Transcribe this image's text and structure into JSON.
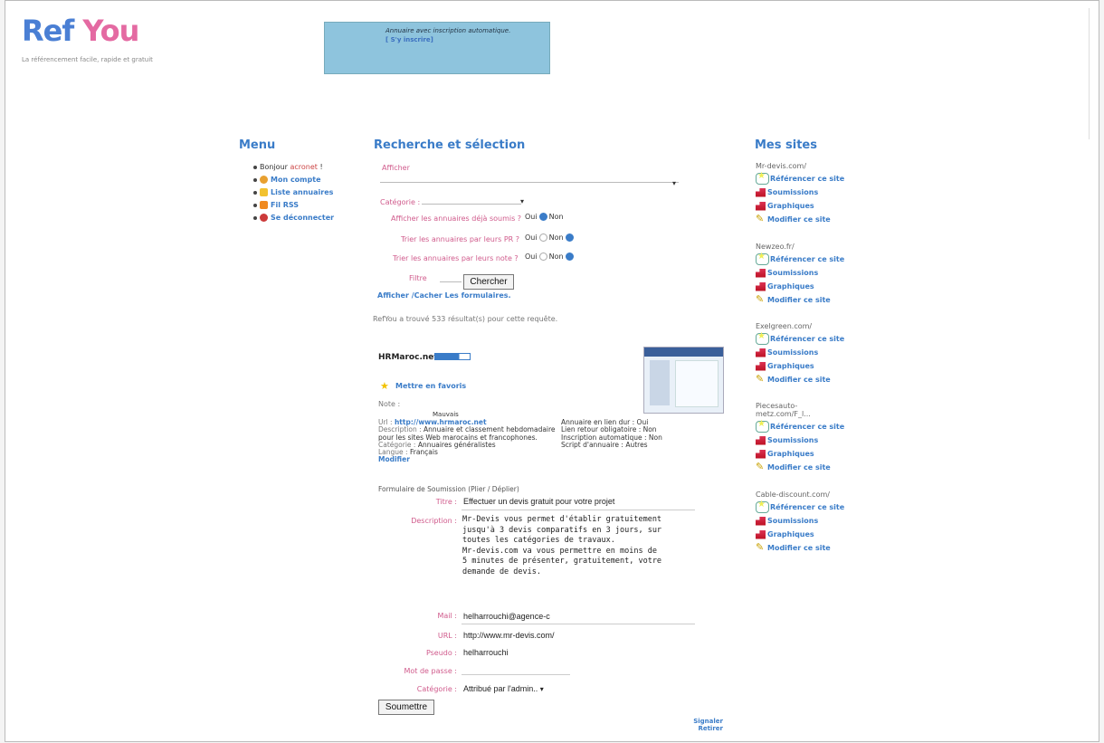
{
  "header": {
    "logo_ref": "Ref",
    "logo_you": "You",
    "tagline": "La référencement facile, rapide et gratuit",
    "banner_text": "Annuaire avec inscription automatique.",
    "banner_link": "[ S'y inscrire]"
  },
  "menu": {
    "title": "Menu",
    "greeting": "Bonjour",
    "username": "acronet",
    "greeting_suffix": "!",
    "items": [
      {
        "label": "Mon compte",
        "icon": "users-icon",
        "color": "#e8a030"
      },
      {
        "label": "Liste annuaires",
        "icon": "folder-icon",
        "color": "#f2c230"
      },
      {
        "label": "Fil RSS",
        "icon": "rss-icon",
        "color": "#f08a20"
      },
      {
        "label": "Se déconnecter",
        "icon": "logout-icon",
        "color": "#cc3a3a"
      }
    ]
  },
  "search": {
    "title": "Recherche et sélection",
    "afficher_label": "Afficher",
    "categorie_label": "Catégorie :",
    "opt1_label": "Afficher les annuaires déjà soumis ?",
    "opt2_label": "Trier les annuaires par leurs PR ?",
    "opt3_label": "Trier les annuaires par leurs note ?",
    "oui": "Oui",
    "non": "Non",
    "filtre_label": "Filtre",
    "search_button": "Chercher",
    "toggle_forms": "Afficher /Cacher Les formulaires.",
    "result_text": "RefYou a trouvé 533 résultat(s) pour cette requête."
  },
  "site_card": {
    "name": "HRMaroc.net",
    "favorite": "Mettre en favoris",
    "note_label": "Note :",
    "note_value": "Mauvais",
    "url_label": "Url :",
    "url_value": "http://www.hrmaroc.net",
    "description_label": "Description :",
    "description_value": "Annuaire et classement hebdomadaire pour les sites Web marocains et francophones.",
    "categorie_label": "Catégorie :",
    "categorie_value": "Annuaires généralistes",
    "langue_label": "Langue :",
    "langue_value": "Français",
    "modifier": "Modifier",
    "annuaire_lien_dur": "Annuaire en lien dur : Oui",
    "lien_retour": "Lien retour obligatoire : Non",
    "inscription_auto": "Inscription automatique : Non",
    "script": "Script d'annuaire : Autres",
    "pr_fraction": 0.7
  },
  "form": {
    "header": "Formulaire de Soumission (Plier / Déplier)",
    "titre_label": "Titre :",
    "titre_value": "Effectuer un devis gratuit pour votre projet",
    "description_label": "Description :",
    "description_value": "Mr-Devis vous permet d'établir gratuitement\njusqu'à 3 devis comparatifs en 3 jours, sur\ntoutes les catégories de travaux.\nMr-devis.com va vous permettre en moins de\n5 minutes de présenter, gratuitement, votre\ndemande de devis.",
    "mail_label": "Mail :",
    "mail_value": "helharrouchi@agence-c",
    "url_label": "URL :",
    "url_value": "http://www.mr-devis.com/",
    "pseudo_label": "Pseudo :",
    "pseudo_value": "helharrouchi",
    "password_label": "Mot de passe :",
    "categorie_label": "Catégorie :",
    "categorie_value": "Attribué par l'admin..",
    "submit": "Soumettre",
    "signaler": "Signaler",
    "retirer": "Retirer"
  },
  "my_sites": {
    "title": "Mes sites",
    "actions": [
      "Référencer ce site",
      "Soumissions",
      "Graphiques",
      "Modifier ce site"
    ],
    "sites": [
      "Mr-devis.com/",
      "Newzeo.fr/",
      "Exelgreen.com/",
      "Piecesauto-metz.com/F_l...",
      "Cable-discount.com/"
    ]
  }
}
